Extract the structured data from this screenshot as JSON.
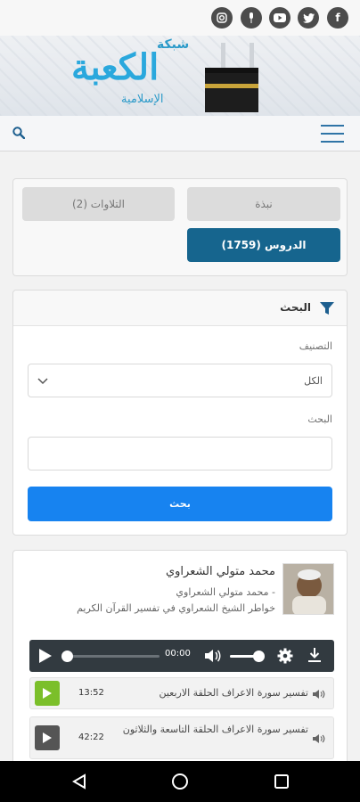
{
  "social": [
    "facebook-icon",
    "twitter-icon",
    "youtube-icon",
    "podcast-icon",
    "instagram-icon"
  ],
  "header": {
    "logo_small": "شبكة",
    "logo_main": "الكعبة",
    "logo_sub": "الإسلامية"
  },
  "tabs": {
    "bio": "نبذة",
    "recitations": "التلاوات (2)",
    "lessons": "الدروس (1759)"
  },
  "search": {
    "title": "البحث",
    "category_label": "التصنيف",
    "category_value": "الكل",
    "search_label": "البحث",
    "search_placeholder": "",
    "button": "بحث"
  },
  "author": {
    "name": "محمد متولي الشعراوي",
    "subtitle": "محمد متولي الشعراوي -",
    "series": "خواطر الشيخ الشعراوي في تفسير القرآن الكريم"
  },
  "player": {
    "time": "00:00",
    "progress": 0,
    "volume": 0.85
  },
  "tracks": [
    {
      "title": "تفسير سورة الاعراف الحلقة الاربعين",
      "duration": "13:52",
      "active": true
    },
    {
      "title": "تفسير سورة الاعراف الحلقة التاسعة والثلاثون",
      "duration": "42:22",
      "active": false
    }
  ],
  "colors": {
    "primary": "#1783f0",
    "tab_active": "#16658e",
    "logo": "#2aa8dd",
    "track_active": "#7bbf2a",
    "player_bg": "#323a40"
  }
}
